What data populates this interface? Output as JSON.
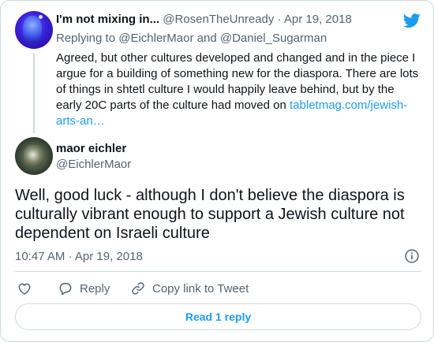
{
  "parent_tweet": {
    "name": "I'm not mixing in...",
    "handle": "@RosenTheUnready",
    "separator": "·",
    "date": "Apr 19, 2018",
    "reply_prefix": "Replying to",
    "reply_user1": "@EichlerMaor",
    "reply_and": "and",
    "reply_user2": "@Daniel_Sugarman",
    "text": "Agreed, but other cultures developed and changed and in the piece I argue for a building of something new for the diaspora. There are lots of things in shtetl culture I would happily leave behind, but by the early 20C parts of the culture had moved on ",
    "link_text": "tabletmag.com/jewish-arts-an…"
  },
  "main_tweet": {
    "name": "maor eichler",
    "handle": "@EichlerMaor",
    "text": "Well, good luck - although I don't believe the diaspora is culturally vibrant enough to support a Jewish culture not dependent on Israeli culture",
    "time": "10:47 AM",
    "separator": "·",
    "date": "Apr 19, 2018"
  },
  "actions": {
    "reply_label": "Reply",
    "copy_label": "Copy link to Tweet"
  },
  "read_replies_label": "Read 1 reply",
  "colors": {
    "accent": "#1d9bf0",
    "muted": "#536471",
    "border": "#cfd9de"
  },
  "icons": [
    "twitter-bird-icon",
    "info-icon",
    "heart-icon",
    "reply-icon",
    "link-icon"
  ]
}
